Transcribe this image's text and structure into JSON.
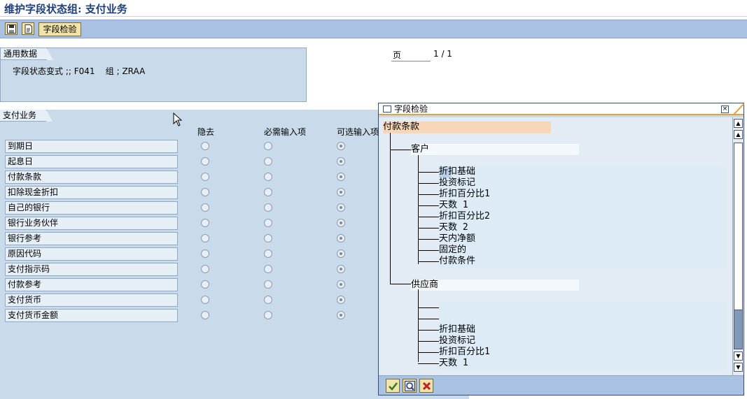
{
  "window": {
    "title": "维护字段状态组: 支付业务"
  },
  "toolbar": {
    "field_check_label": "字段检验",
    "icons": [
      "save-icon",
      "new-page-icon"
    ]
  },
  "general": {
    "tab_label": "通用数据",
    "status_variant_text": "字段状态变式 ;; F041    组 ; ZRAA"
  },
  "pagination": {
    "label": "页",
    "value": "1 / 1"
  },
  "payment": {
    "tab_label": "支付业务",
    "columns": [
      "隐去",
      "必需输入项",
      "可选输入项"
    ],
    "rows": [
      {
        "label": "到期日",
        "state": "optional"
      },
      {
        "label": "起息日",
        "state": "optional"
      },
      {
        "label": "付款条款",
        "state": "optional"
      },
      {
        "label": "扣除现金折扣",
        "state": "optional"
      },
      {
        "label": "自己的银行",
        "state": "optional"
      },
      {
        "label": "银行业务伙伴",
        "state": "optional"
      },
      {
        "label": "银行参考",
        "state": "optional"
      },
      {
        "label": "原因代码",
        "state": "optional"
      },
      {
        "label": "支付指示码",
        "state": "optional"
      },
      {
        "label": "付款参考",
        "state": "optional"
      },
      {
        "label": "支付货币",
        "state": "optional"
      },
      {
        "label": "支付货币金额",
        "state": "optional"
      }
    ]
  },
  "popup": {
    "title": "字段检验",
    "root": "付款条款",
    "customer": {
      "label": "客户",
      "children": [
        "折扣基础",
        "投资标记",
        "折扣百分比1",
        "天数 1",
        "折扣百分比2",
        "天数 2",
        "天内净额",
        "固定的",
        "付款条件"
      ]
    },
    "vendor": {
      "label": "供应商",
      "children": [
        "",
        "",
        "折扣基础",
        "投资标记",
        "折扣百分比1",
        "天数 1"
      ]
    },
    "footer_buttons": [
      "check-icon",
      "search-icon",
      "cancel-icon"
    ],
    "colors": {
      "root_highlight": "#f8d7b8",
      "node_highlight": "#dcebf6",
      "accent": "#e8a03a"
    }
  }
}
